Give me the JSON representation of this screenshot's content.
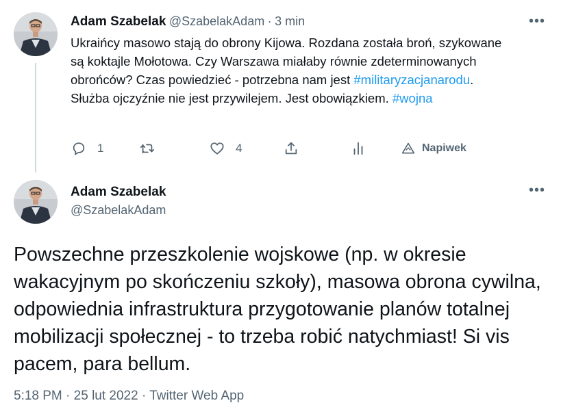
{
  "reply_tweet": {
    "author_name": "Adam Szabelak",
    "author_handle": "@SzabelakAdam",
    "separator": "·",
    "time_ago": "3 min",
    "more_label": "•••",
    "text_part1": "Ukraińcy masowo stają do obrony Kijowa. Rozdana została broń, szykowane są koktajle Mołotowa. Czy Warszawa miałaby równie zdeterminowanych obrońców? Czas powiedzieć - potrzebna nam jest ",
    "hashtag1": "#militaryzacjanarodu",
    "text_part2": ". Służba ojczyźnie nie jest przywilejem. Jest obowiązkiem. ",
    "hashtag2": "#wojna",
    "actions": {
      "reply_count": "1",
      "like_count": "4",
      "tip_label": "Napiwek"
    }
  },
  "main_tweet": {
    "author_name": "Adam Szabelak",
    "author_handle": "@SzabelakAdam",
    "more_label": "•••",
    "text": "Powszechne przeszkolenie wojskowe (np. w okresie wakacyjnym po skończeniu szkoły), masowa obrona cywilna, odpowiednia infrastruktura przygotowanie planów totalnej mobilizacji społecznej - to trzeba robić natychmiast! Si vis pacem, para bellum.",
    "time": "5:18 PM",
    "date": "25 lut 2022",
    "source": "Twitter Web App",
    "meta_separator": "·"
  },
  "icons": {
    "reply": "reply-icon",
    "retweet": "retweet-icon",
    "like": "heart-icon",
    "share": "share-icon",
    "analytics": "analytics-icon",
    "tip": "tip-icon"
  },
  "colors": {
    "link": "#1d9bf0",
    "secondary": "#536471",
    "primary": "#0f1419",
    "thread_line": "#cfd9de"
  }
}
